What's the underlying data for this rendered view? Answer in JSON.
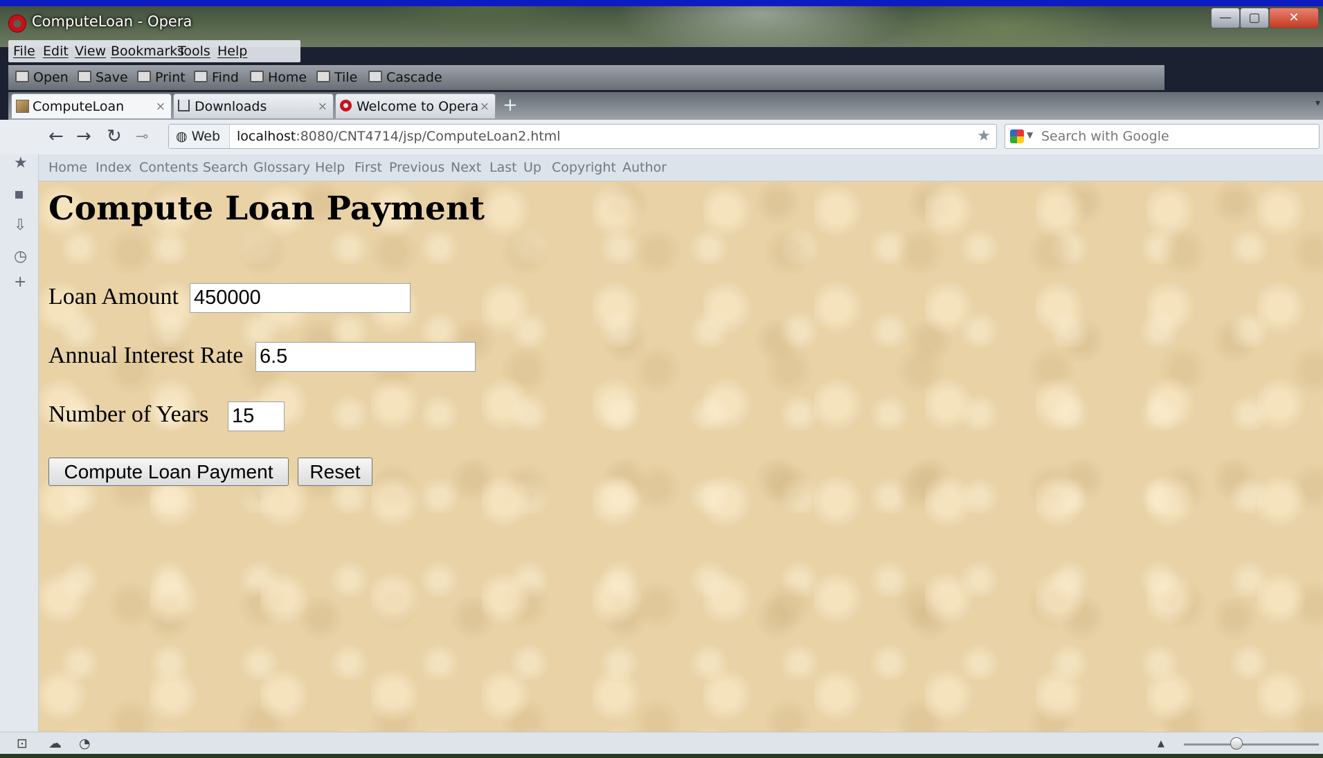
{
  "window": {
    "title": "ComputeLoan - Opera",
    "controls": {
      "minimize": "—",
      "maximize": "▢",
      "close": "✕"
    }
  },
  "menu": [
    "File",
    "Edit",
    "View",
    "Bookmarks",
    "Tools",
    "Help"
  ],
  "toolbar": [
    "Open",
    "Save",
    "Print",
    "Find",
    "Home",
    "Tile",
    "Cascade"
  ],
  "tabs": [
    {
      "label": "ComputeLoan",
      "icon": "page-icon",
      "active": true
    },
    {
      "label": "Downloads",
      "icon": "downloads-icon",
      "active": false
    },
    {
      "label": "Welcome to Opera",
      "icon": "opera-icon",
      "active": false
    }
  ],
  "address": {
    "scope": "Web",
    "host": "localhost",
    "path": ":8080/CNT4714/jsp/ComputeLoan2.html"
  },
  "search": {
    "placeholder": "Search with Google"
  },
  "nav_links": [
    "Home",
    "Index",
    "Contents",
    "Search",
    "Glossary",
    "Help",
    "First",
    "Previous",
    "Next",
    "Last",
    "Up",
    "Copyright",
    "Author"
  ],
  "page": {
    "title": "Compute Loan Payment",
    "fields": {
      "amount": {
        "label": "Loan Amount",
        "value": "450000"
      },
      "rate": {
        "label": "Annual Interest Rate",
        "value": "6.5"
      },
      "years": {
        "label": "Number of Years",
        "value": "15"
      }
    },
    "buttons": {
      "compute": "Compute Loan Payment",
      "reset": "Reset"
    }
  },
  "colors": {
    "page_background": "#e8d2a6",
    "titlebar_accent": "#0d1bc2"
  }
}
